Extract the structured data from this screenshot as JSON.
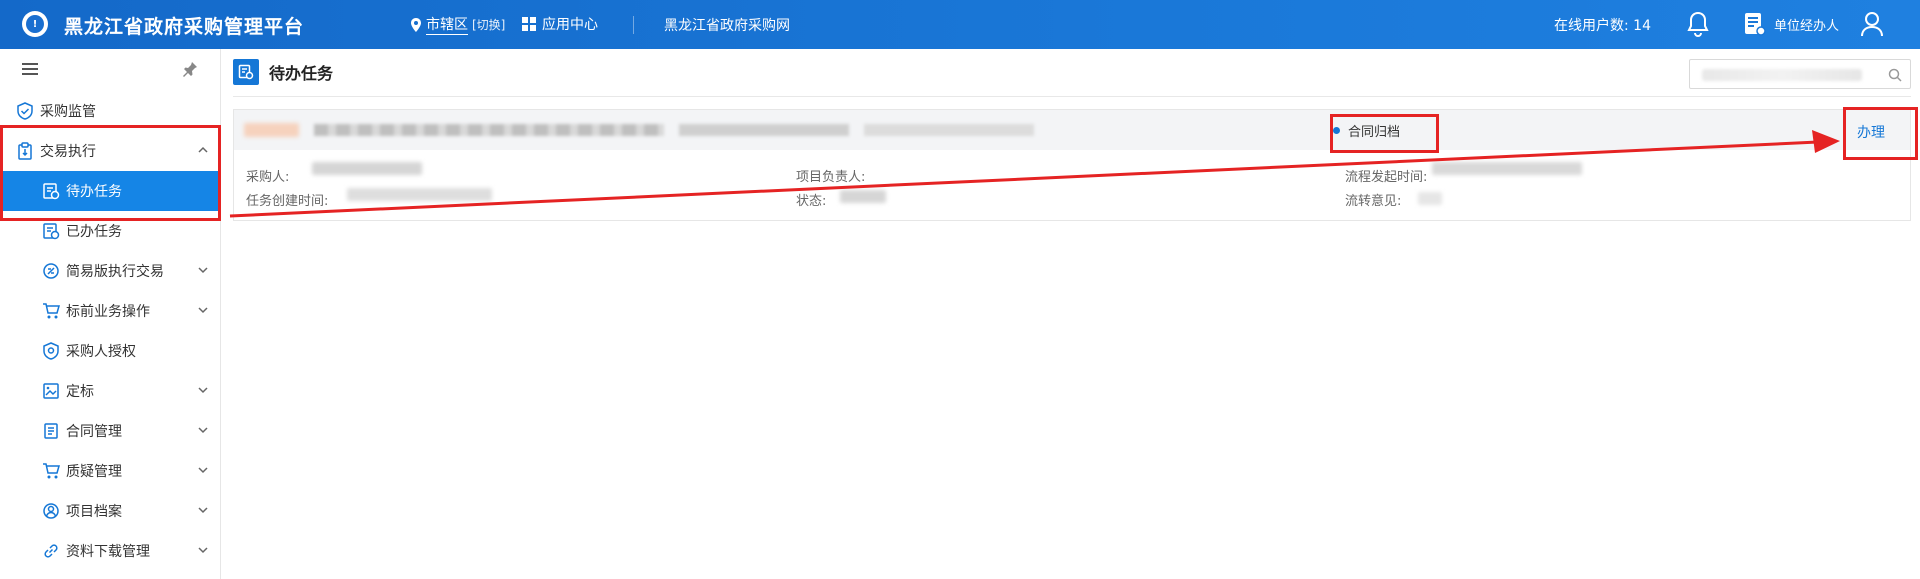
{
  "header": {
    "logo_char": "!",
    "title": "黑龙江省政府采购管理平台",
    "region": "市辖区",
    "switch": "[切换]",
    "app_center": "应用中心",
    "site_link": "黑龙江省政府采购网",
    "online_users": "在线用户数: 14",
    "role": "单位经办人"
  },
  "sidebar": {
    "items": [
      {
        "label": "采购监管",
        "icon": "shield-check-icon"
      },
      {
        "label": "交易执行",
        "icon": "clipboard-icon"
      },
      {
        "label": "待办任务",
        "icon": "task-icon"
      },
      {
        "label": "已办任务",
        "icon": "task-done-icon"
      },
      {
        "label": "简易版执行交易",
        "icon": "trade-icon"
      },
      {
        "label": "标前业务操作",
        "icon": "cart-icon"
      },
      {
        "label": "采购人授权",
        "icon": "badge-icon"
      },
      {
        "label": "定标",
        "icon": "image-icon"
      },
      {
        "label": "合同管理",
        "icon": "document-icon"
      },
      {
        "label": "质疑管理",
        "icon": "cart-icon"
      },
      {
        "label": "项目档案",
        "icon": "user-circle-icon"
      },
      {
        "label": "资料下载管理",
        "icon": "link-icon"
      }
    ]
  },
  "content": {
    "title": "待办任务",
    "task": {
      "status": "合同归档",
      "action": "办理",
      "fields": {
        "purchaser": "采购人:",
        "project_leader": "项目负责人:",
        "flow_start_time": "流程发起时间:",
        "task_create_time": "任务创建时间:",
        "state": "状态:",
        "transfer_opinion": "流转意见:"
      }
    }
  },
  "colors": {
    "header": "#1a78d8",
    "active": "#1585e6",
    "highlight": "#e52323",
    "accent": "#1577d6"
  }
}
